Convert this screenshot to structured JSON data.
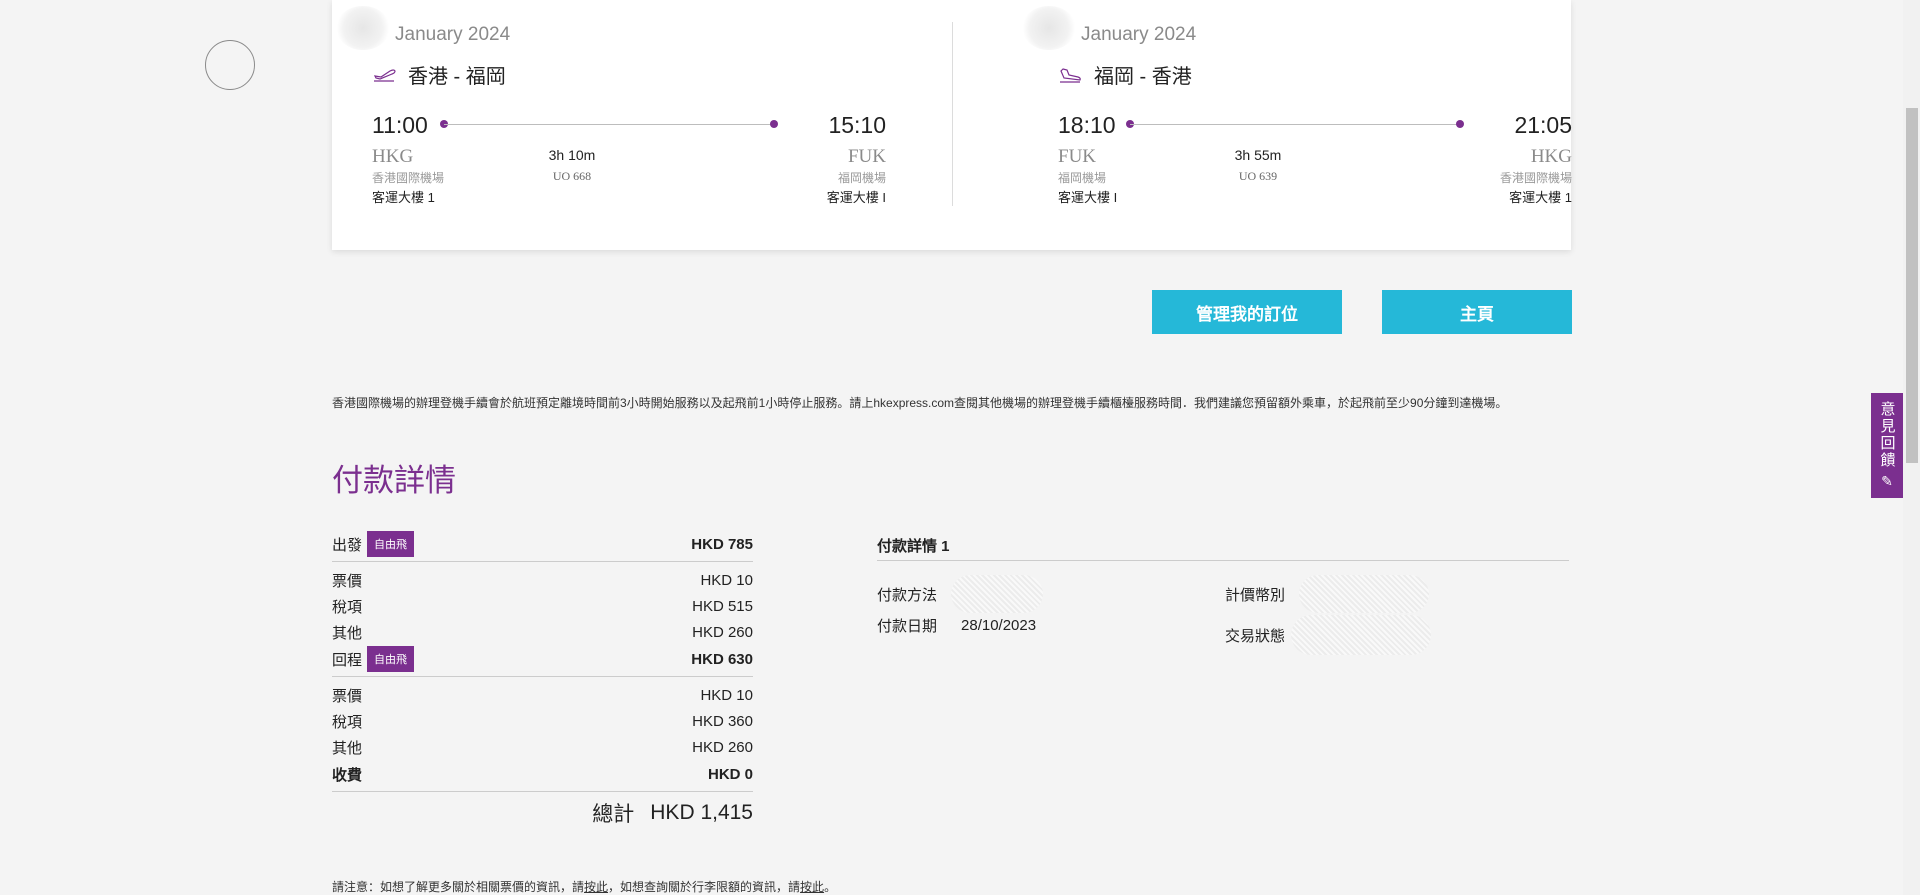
{
  "outbound": {
    "month": "January 2024",
    "route": "香港 - 福岡",
    "dep_time": "11:00",
    "arr_time": "15:10",
    "dep_code": "HKG",
    "arr_code": "FUK",
    "dep_airport": "香港國際機場",
    "arr_airport": "福岡機場",
    "dep_terminal": "客運大樓 1",
    "arr_terminal": "客運大樓 I",
    "duration": "3h 10m",
    "flight_no": "UO 668"
  },
  "return": {
    "month": "January 2024",
    "route": "福岡 - 香港",
    "dep_time": "18:10",
    "arr_time": "21:05",
    "dep_code": "FUK",
    "arr_code": "HKG",
    "dep_airport": "福岡機場",
    "arr_airport": "香港國際機場",
    "dep_terminal": "客運大樓 I",
    "arr_terminal": "客運大樓 1",
    "duration": "3h 55m",
    "flight_no": "UO 639"
  },
  "buttons": {
    "manage": "管理我的訂位",
    "home": "主頁"
  },
  "notice": "香港國際機場的辦理登機手續會於航班預定離境時間前3小時開始服務以及起飛前1小時停止服務。請上hkexpress.com查閱其他機場的辦理登機手續櫃檯服務時間．我們建議您預留額外乘車，於起飛前至少90分鐘到達機場。",
  "payment": {
    "title": "付款詳情",
    "departure": {
      "label": "出發",
      "badge": "自由飛",
      "amount": "HKD 785",
      "items": [
        {
          "label": "票價",
          "amount": "HKD 10"
        },
        {
          "label": "稅項",
          "amount": "HKD 515"
        },
        {
          "label": "其他",
          "amount": "HKD 260"
        }
      ]
    },
    "return": {
      "label": "回程",
      "badge": "自由飛",
      "amount": "HKD 630",
      "items": [
        {
          "label": "票價",
          "amount": "HKD 10"
        },
        {
          "label": "稅項",
          "amount": "HKD 360"
        },
        {
          "label": "其他",
          "amount": "HKD 260"
        }
      ]
    },
    "fees": {
      "label": "收費",
      "amount": "HKD 0"
    },
    "total": {
      "label": "總計",
      "amount": "HKD 1,415"
    }
  },
  "payment_detail": {
    "title": "付款詳情 1",
    "method_label": "付款方法",
    "date_label": "付款日期",
    "date_value": "28/10/2023",
    "currency_label": "計價幣別",
    "status_label": "交易狀態"
  },
  "footnote": {
    "prefix": "請注意：如想了解更多關於相關票價的資訊，請",
    "link1": "按此",
    "middle": "，如想查詢關於行李限額的資訊，請",
    "link2": "按此",
    "suffix": "。"
  },
  "feedback": {
    "label": "意見回饋",
    "icon": "edit-icon"
  },
  "colors": {
    "accent": "#7b2f8f",
    "button": "#25b8d8"
  }
}
